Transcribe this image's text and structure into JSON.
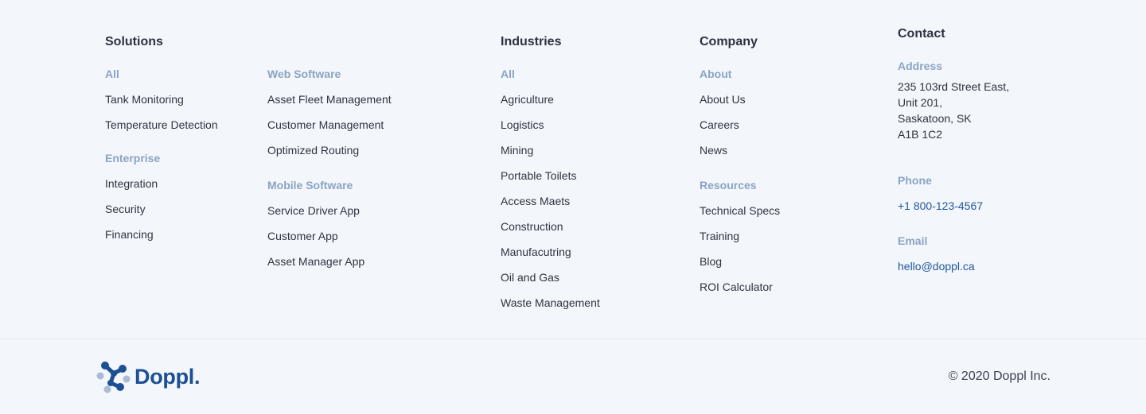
{
  "solutions": {
    "heading": "Solutions",
    "all_label": "All",
    "all_items": [
      "Tank Monitoring",
      "Temperature Detection"
    ],
    "enterprise_label": "Enterprise",
    "enterprise_items": [
      "Integration",
      "Security",
      "Financing"
    ],
    "web_label": "Web Software",
    "web_items": [
      "Asset Fleet Management",
      "Customer Management",
      "Optimized Routing"
    ],
    "mobile_label": "Mobile Software",
    "mobile_items": [
      "Service Driver App",
      "Customer App",
      "Asset Manager App"
    ]
  },
  "industries": {
    "heading": "Industries",
    "all_label": "All",
    "items": [
      "Agriculture",
      "Logistics",
      "Mining",
      "Portable Toilets",
      "Access Maets",
      "Construction",
      "Manufacutring",
      "Oil and Gas",
      "Waste Management"
    ]
  },
  "company": {
    "heading": "Company",
    "about_label": "About",
    "about_items": [
      "About Us",
      "Careers",
      "News"
    ],
    "resources_label": "Resources",
    "resources_items": [
      "Technical Specs",
      "Training",
      "Blog",
      "ROI Calculator"
    ]
  },
  "contact": {
    "heading": "Contact",
    "address_label": "Address",
    "address_lines": [
      "235 103rd Street East,",
      "Unit 201,",
      "Saskatoon, SK",
      "A1B 1C2"
    ],
    "phone_label": "Phone",
    "phone": "+1 800-123-4567",
    "email_label": "Email",
    "email": "hello@doppl.ca"
  },
  "bottom": {
    "logo_text": "Doppl.",
    "copyright": "© 2020 Doppl Inc."
  },
  "colors": {
    "background": "#f3f6fb",
    "group_label": "#8ba4c4",
    "link": "#2f3440",
    "contact_link": "#21599b",
    "brand": "#1d4f93",
    "brand_light": "#a9bbd6"
  },
  "icons": {
    "logo": "doppl-logo-icon"
  }
}
